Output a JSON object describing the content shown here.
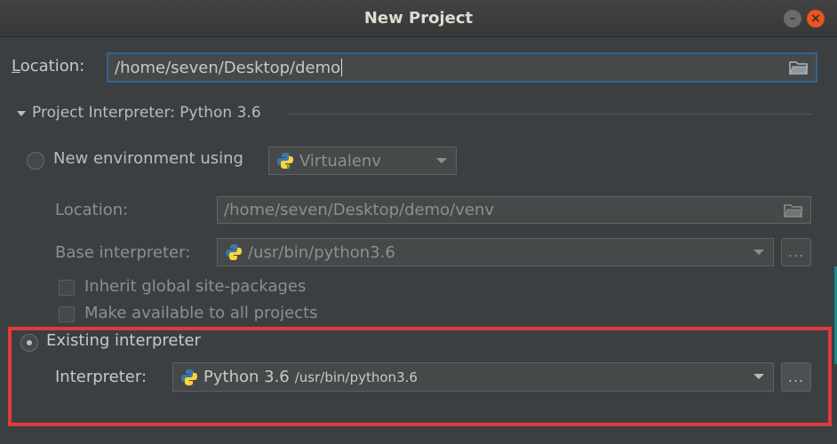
{
  "window": {
    "title": "New Project",
    "minimize_glyph": "–",
    "close_glyph": "×"
  },
  "project": {
    "location_label": "Location:",
    "location_mnemonic": "L",
    "location_label_rest": "ocation:",
    "location_value": "/home/seven/Desktop/demo"
  },
  "interpreter_section": {
    "title": "Project Interpreter: Python 3.6"
  },
  "new_env": {
    "radio_label": "New environment using",
    "selected": false,
    "tool_value": "Virtualenv",
    "location_label": "Location:",
    "location_value": "/home/seven/Desktop/demo/venv",
    "base_label": "Base interpreter:",
    "base_value": "/usr/bin/python3.6",
    "inherit_label": "Inherit global site-packages",
    "inherit_checked": false,
    "make_available_label": "Make available to all projects",
    "make_available_checked": false,
    "browse_label": "..."
  },
  "existing": {
    "radio_label": "Existing interpreter",
    "selected": true,
    "interpreter_label": "Interpreter:",
    "interpreter_name": "Python 3.6",
    "interpreter_path": "/usr/bin/python3.6",
    "browse_label": "..."
  },
  "colors": {
    "background": "#3c3f41",
    "highlight_border": "#e03a3c",
    "focus_border": "#3d6185"
  },
  "icons": [
    "minimize-icon",
    "close-icon",
    "folder-icon",
    "python-icon",
    "virtualenv-icon",
    "chevron-down-icon",
    "expand-triangle-icon"
  ]
}
